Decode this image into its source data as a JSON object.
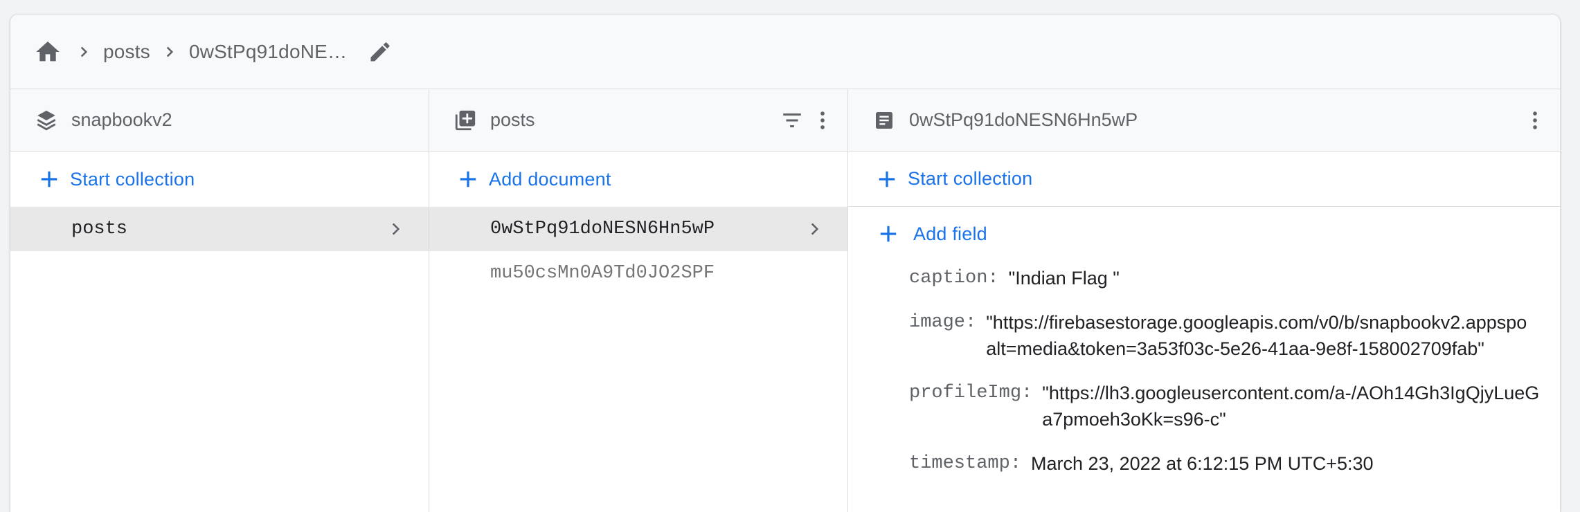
{
  "breadcrumb": {
    "items": [
      "posts",
      "0wStPq91doNE…"
    ]
  },
  "panels": {
    "root": {
      "title": "snapbookv2",
      "action": "Start collection",
      "items": [
        {
          "label": "posts"
        }
      ]
    },
    "collection": {
      "title": "posts",
      "action": "Add document",
      "items": [
        {
          "label": "0wStPq91doNESN6Hn5wP"
        },
        {
          "label": "mu50csMn0A9Td0JO2SPF"
        }
      ]
    },
    "document": {
      "title": "0wStPq91doNESN6Hn5wP",
      "start_collection": "Start collection",
      "add_field": "Add field",
      "fields": [
        {
          "key": "caption:",
          "lines": [
            "\"Indian Flag \""
          ]
        },
        {
          "key": "image:",
          "lines": [
            "\"https://firebasestorage.googleapis.com/v0/b/snapbookv2.appspo",
            "alt=media&token=3a53f03c-5e26-41aa-9e8f-158002709fab\""
          ]
        },
        {
          "key": "profileImg:",
          "lines": [
            "\"https://lh3.googleusercontent.com/a-/AOh14Gh3IgQjyLueG",
            "a7pmoeh3oKk=s96-c\""
          ]
        },
        {
          "key": "timestamp:",
          "lines": [
            "March 23, 2022 at 6:12:15 PM UTC+5:30"
          ]
        }
      ]
    }
  },
  "icons": {
    "home": "home-icon",
    "separator": "chevron-right-icon",
    "edit": "pencil-icon",
    "database": "layers-icon",
    "collection": "collection-stack-icon",
    "document": "document-icon",
    "filter": "filter-icon",
    "more": "more-vert-icon",
    "add": "plus-icon"
  },
  "colors": {
    "accent": "#1a73e8",
    "header_bg": "#f8f9fa",
    "selected_bg": "#e8e8e8",
    "icon_gray": "#5f6368"
  }
}
